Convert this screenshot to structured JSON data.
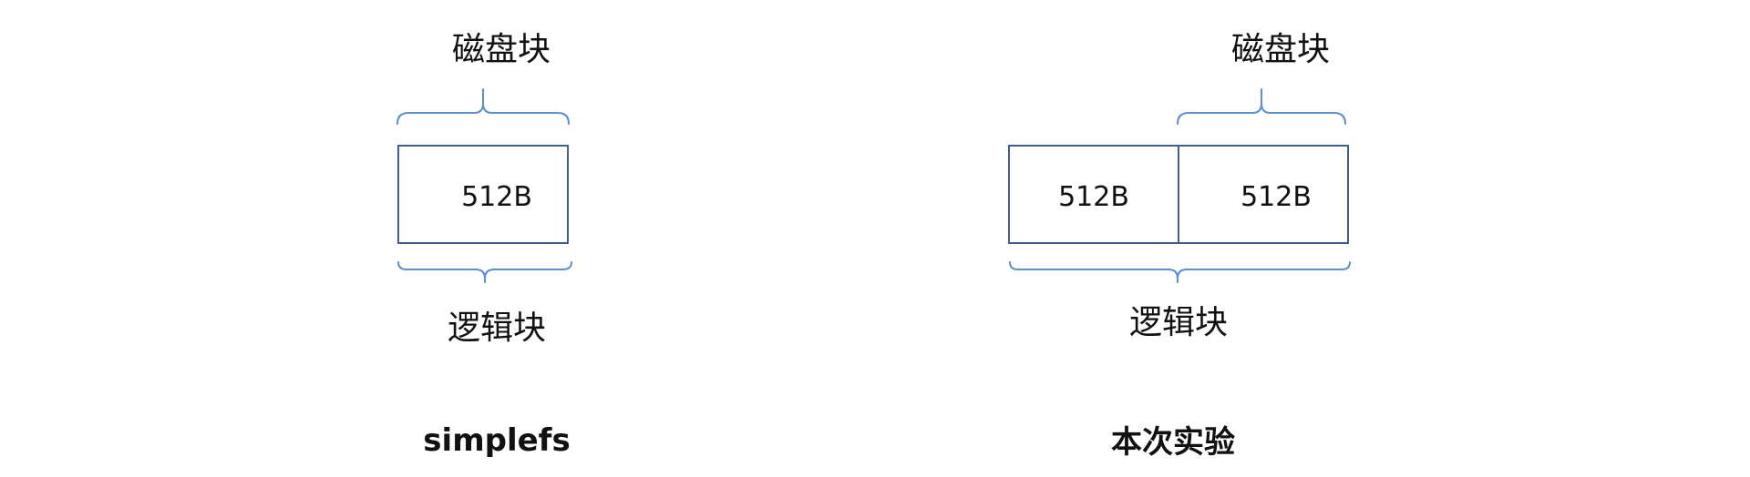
{
  "colors": {
    "box_border": "#3f5f8f",
    "brace": "#5b8fd0",
    "text": "#111111"
  },
  "left": {
    "top_label": "磁盘块",
    "cell": "512B",
    "bottom_label": "逻辑块",
    "caption": "simplefs"
  },
  "right": {
    "top_label": "磁盘块",
    "cells": [
      "512B",
      "512B"
    ],
    "bottom_label": "逻辑块",
    "caption": "本次实验"
  }
}
